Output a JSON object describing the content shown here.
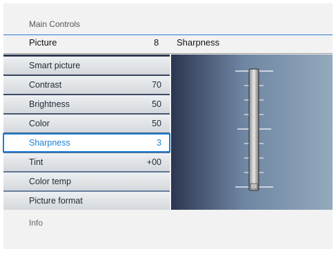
{
  "breadcrumb": "Main Controls",
  "header": {
    "title": "Picture",
    "count": "8",
    "selected_item": "Sharpness"
  },
  "menu": [
    {
      "label": "Smart picture",
      "value": ""
    },
    {
      "label": "Contrast",
      "value": "70"
    },
    {
      "label": "Brightness",
      "value": "50"
    },
    {
      "label": "Color",
      "value": "50"
    },
    {
      "label": "Sharpness",
      "value": "3",
      "selected": true
    },
    {
      "label": "Tint",
      "value": "+00"
    },
    {
      "label": "Color temp",
      "value": ""
    },
    {
      "label": "Picture format",
      "value": ""
    }
  ],
  "slider": {
    "name": "Sharpness",
    "value_fraction": 0.0
  },
  "footer": {
    "info": "Info"
  },
  "colors": {
    "accent": "#1b7fd6",
    "header_line": "#2a7fd2",
    "panel_dark": "#2c3650",
    "panel_light": "#93a9bd"
  }
}
